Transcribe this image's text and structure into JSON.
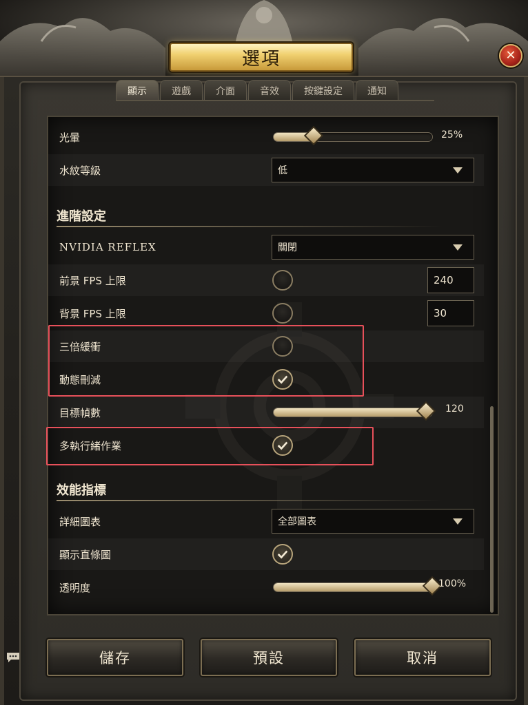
{
  "window": {
    "title": "選項",
    "close_icon": "close-icon"
  },
  "tabs": [
    {
      "label": "顯示",
      "active": true
    },
    {
      "label": "遊戲",
      "active": false
    },
    {
      "label": "介面",
      "active": false
    },
    {
      "label": "音效",
      "active": false
    },
    {
      "label": "按鍵設定",
      "active": false
    },
    {
      "label": "通知",
      "active": false
    }
  ],
  "settings": {
    "bloom": {
      "label": "光暈",
      "value_text": "25%",
      "fraction": 0.25
    },
    "water_ripple": {
      "label": "水紋等級",
      "value": "低"
    },
    "advanced_section": "進階設定",
    "nvidia_reflex": {
      "label": "NVIDIA REFLEX",
      "value": "關閉"
    },
    "fg_fps": {
      "label": "前景 FPS 上限",
      "checked": false,
      "value": "240"
    },
    "bg_fps": {
      "label": "背景 FPS 上限",
      "checked": false,
      "value": "30"
    },
    "triple_buffer": {
      "label": "三倍緩衝",
      "checked": false
    },
    "dynamic_cull": {
      "label": "動態刪減",
      "checked": true
    },
    "target_fps": {
      "label": "目標幀數",
      "value_text": "120",
      "fraction": 0.96
    },
    "multithread": {
      "label": "多執行緒作業",
      "checked": true
    },
    "perf_section": "效能指標",
    "detail_chart": {
      "label": "詳細圖表",
      "value": "全部圖表"
    },
    "show_bar": {
      "label": "顯示直條圖",
      "checked": true
    },
    "opacity": {
      "label": "透明度",
      "value_text": "100%",
      "fraction": 1.0
    }
  },
  "buttons": {
    "save": "儲存",
    "default": "預設",
    "cancel": "取消"
  },
  "colors": {
    "highlight": "#e7505a",
    "gold": "#f0d070"
  }
}
